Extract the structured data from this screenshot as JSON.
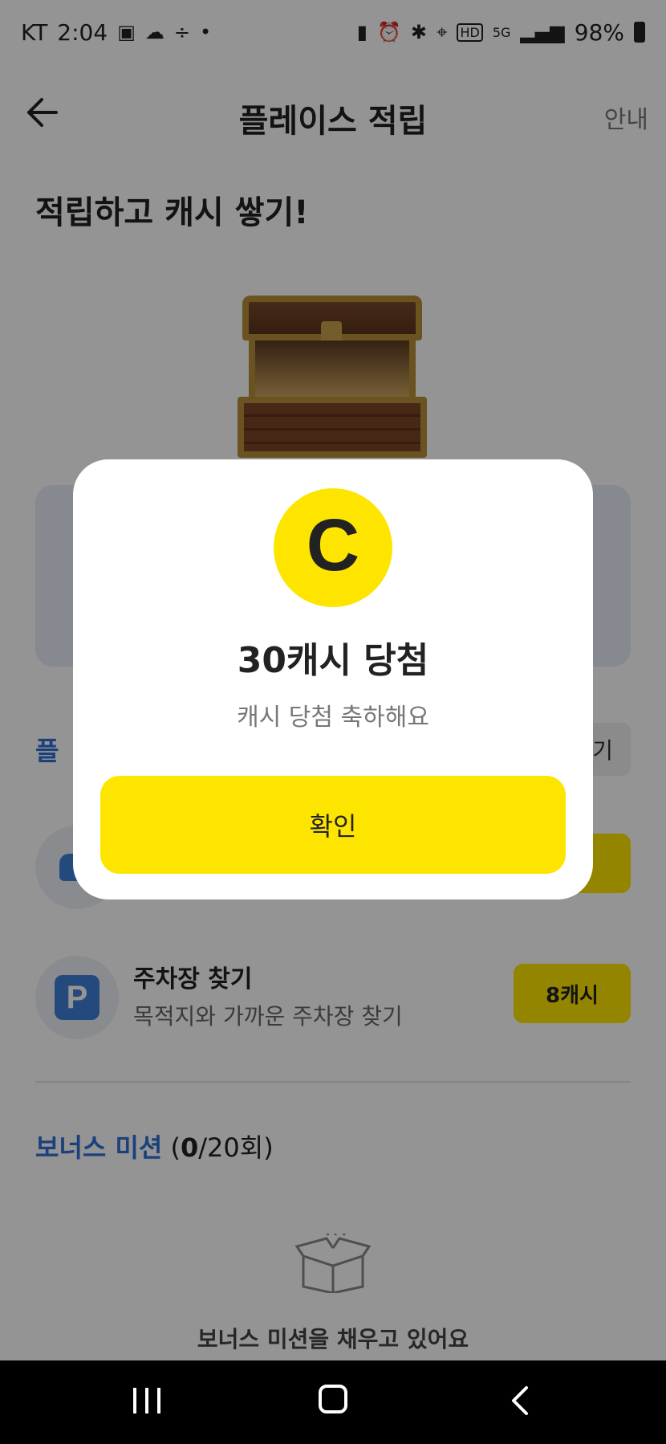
{
  "status_bar": {
    "carrier": "KT",
    "time": "2:04",
    "battery": "98%",
    "icons_left": [
      "image-icon",
      "cloud-icon",
      "divide-icon",
      "dot-icon"
    ],
    "icons_right": [
      "battery-saver-icon",
      "alarm-icon",
      "bluetooth-icon",
      "location-icon",
      "hd-icon",
      "5g-icon",
      "signal-icon",
      "battery-icon"
    ]
  },
  "header": {
    "title": "플레이스 적립",
    "guide_link": "안내"
  },
  "headline": "적립하고 캐시 쌓기!",
  "section": {
    "title": "플",
    "button_label": "기"
  },
  "missions": [
    {
      "title": "",
      "desc": "",
      "reward": "",
      "icon": "car-icon"
    },
    {
      "title": "주차장 찾기",
      "desc": "목적지와 가까운 주차장 찾기",
      "reward": "8캐시",
      "icon": "parking-icon"
    }
  ],
  "parking_icon_letter": "P",
  "bonus": {
    "title": "보너스 미션",
    "count_open": " (",
    "count_done": "0",
    "count_rest": "/20회)",
    "empty_text": "보너스 미션을 채우고 있어요"
  },
  "modal": {
    "coin_letter": "C",
    "title": "30캐시 당첨",
    "subtitle": "캐시 당첨 축하해요",
    "confirm_label": "확인"
  },
  "colors": {
    "accent_yellow": "#fee500",
    "link_blue": "#2f6fd6",
    "dim_overlay": "rgba(0,0,0,0.42)"
  }
}
